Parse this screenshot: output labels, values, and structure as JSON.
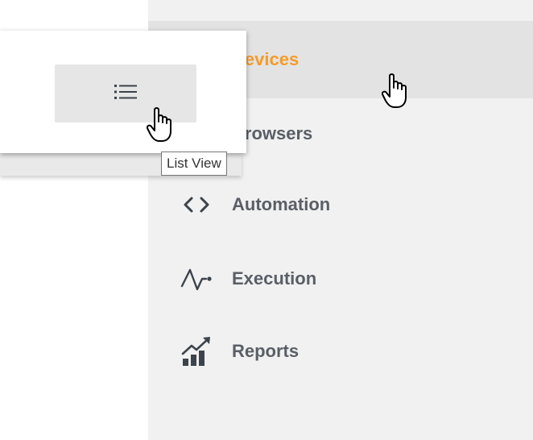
{
  "sidebar": {
    "items": [
      {
        "label": "Devices",
        "icon": "devices-icon",
        "active": true
      },
      {
        "label": "Browsers",
        "icon": "browser-icon",
        "active": false
      },
      {
        "label": "Automation",
        "icon": "code-brackets-icon",
        "active": false
      },
      {
        "label": "Execution",
        "icon": "pulse-icon",
        "active": false
      },
      {
        "label": "Reports",
        "icon": "chart-growth-icon",
        "active": false
      }
    ]
  },
  "toolbar": {
    "list_view_icon": "list-icon"
  },
  "tooltip": {
    "text": "List View"
  },
  "colors": {
    "active_label": "#f39c2b",
    "label": "#5a5f66",
    "sidebar_bg": "#f1f1f1",
    "active_bg": "#e3e3e3"
  }
}
